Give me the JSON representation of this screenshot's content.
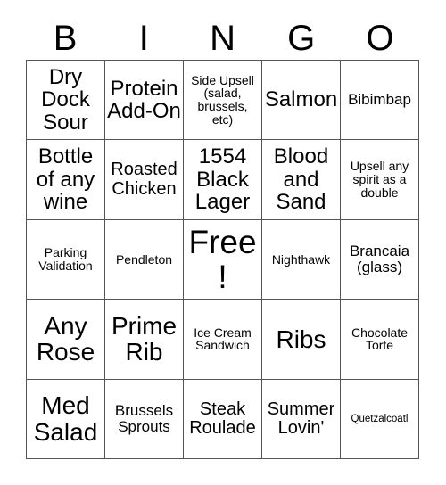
{
  "card": {
    "title": "BINGO",
    "header_letters": [
      "B",
      "I",
      "N",
      "G",
      "O"
    ],
    "free_space_label": "Free!",
    "grid": {
      "rows": 5,
      "columns": 5,
      "cells": [
        [
          {
            "text": "Dry Dock Sour",
            "size": "lg"
          },
          {
            "text": "Protein Add-On",
            "size": "lg"
          },
          {
            "text": "Side Upsell (salad, brussels, etc)",
            "size": "xs"
          },
          {
            "text": "Salmon",
            "size": "lg"
          },
          {
            "text": "Bibimbap",
            "size": "sm"
          }
        ],
        [
          {
            "text": "Bottle of any wine",
            "size": "lg"
          },
          {
            "text": "Roasted Chicken",
            "size": "md"
          },
          {
            "text": "1554 Black Lager",
            "size": "lg"
          },
          {
            "text": "Blood and Sand",
            "size": "lg"
          },
          {
            "text": "Upsell any spirit as a double",
            "size": "xs"
          }
        ],
        [
          {
            "text": "Parking Validation",
            "size": "xs"
          },
          {
            "text": "Pendleton",
            "size": "xs"
          },
          {
            "text": "Free!",
            "size": "xxl"
          },
          {
            "text": "Nighthawk",
            "size": "xs"
          },
          {
            "text": "Brancaia (glass)",
            "size": "sm"
          }
        ],
        [
          {
            "text": "Any Rose",
            "size": "xl"
          },
          {
            "text": "Prime Rib",
            "size": "xl"
          },
          {
            "text": "Ice Cream Sandwich",
            "size": "xs"
          },
          {
            "text": "Ribs",
            "size": "xl"
          },
          {
            "text": "Chocolate Torte",
            "size": "xs"
          }
        ],
        [
          {
            "text": "Med Salad",
            "size": "xl"
          },
          {
            "text": "Brussels Sprouts",
            "size": "sm"
          },
          {
            "text": "Steak Roulade",
            "size": "md"
          },
          {
            "text": "Summer Lovin'",
            "size": "md"
          },
          {
            "text": "Quetzalcoatl",
            "size": "xxs"
          }
        ]
      ]
    },
    "colors": {
      "background": "#ffffff",
      "text": "#000000",
      "grid_line": "#555555"
    }
  }
}
